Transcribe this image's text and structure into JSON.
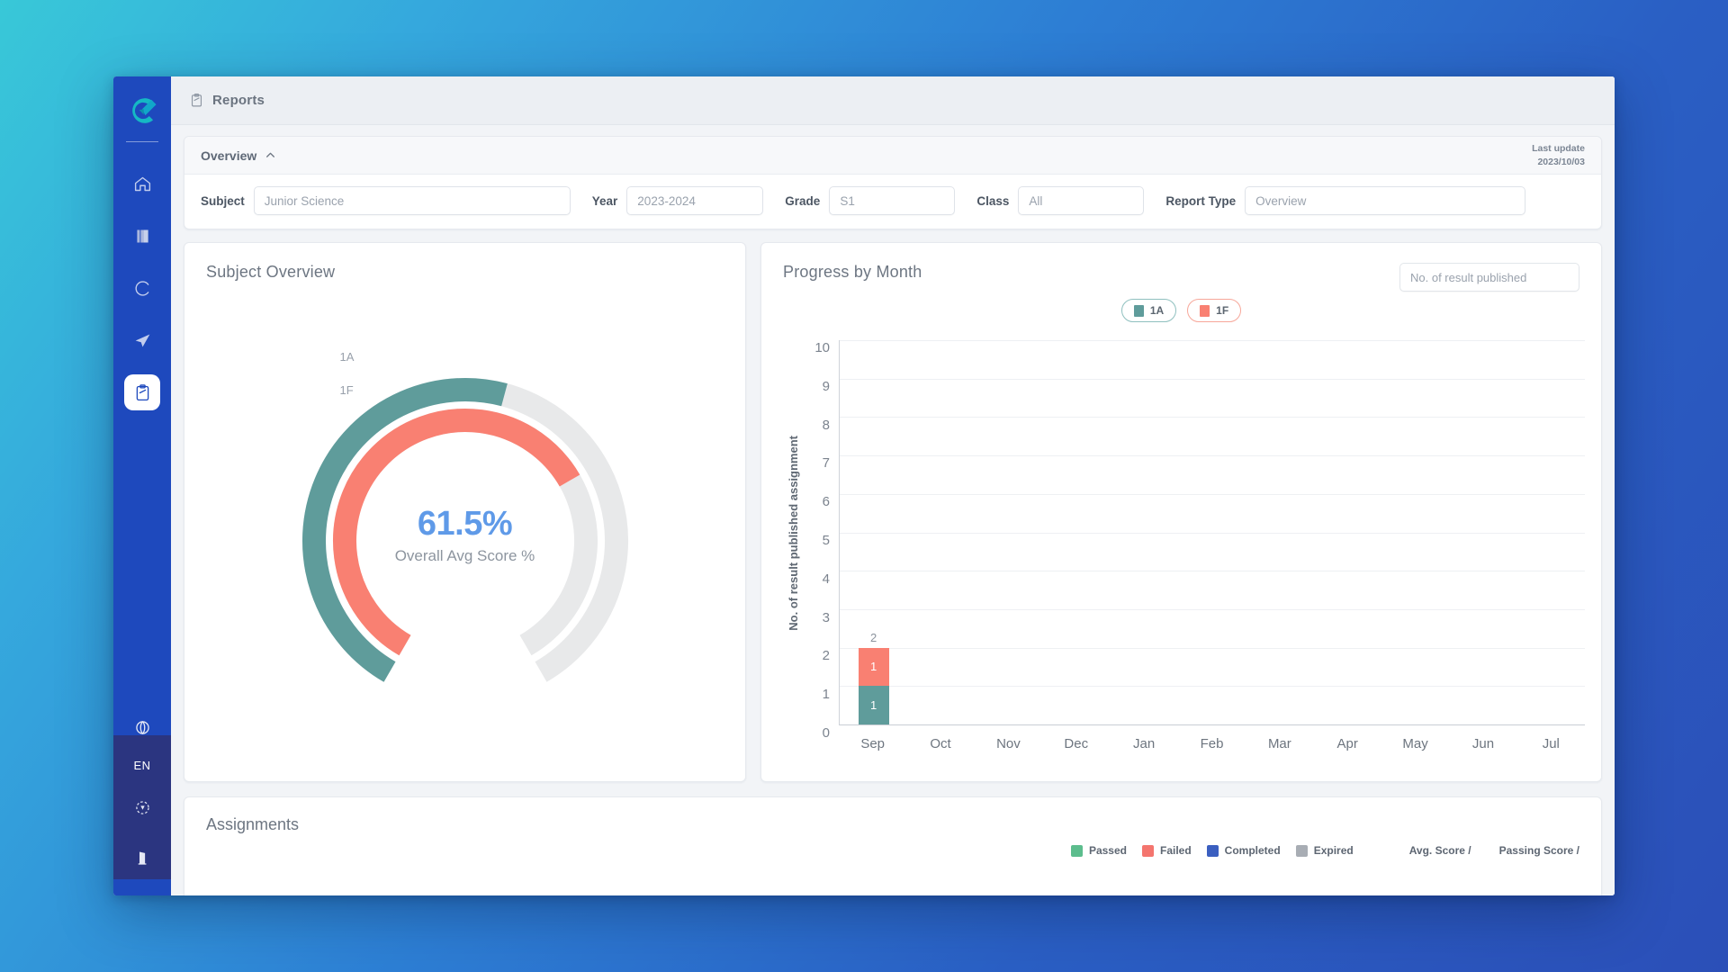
{
  "window": {
    "topbar": {
      "title": "Reports",
      "icon": "clipboard-icon"
    }
  },
  "sidebar": {
    "logo": "e-logo",
    "items": [
      {
        "name": "home",
        "icon": "home-icon"
      },
      {
        "name": "library",
        "icon": "book-icon"
      },
      {
        "name": "history",
        "icon": "clock-icon"
      },
      {
        "name": "messages",
        "icon": "paper-plane-icon"
      },
      {
        "name": "reports",
        "icon": "clipboard-icon",
        "active": true
      }
    ],
    "bottom_items": [
      {
        "name": "globe",
        "icon": "globe-icon"
      },
      {
        "name": "language",
        "label": "EN"
      },
      {
        "name": "help",
        "icon": "help-icon"
      },
      {
        "name": "logout",
        "icon": "door-exit-icon"
      }
    ]
  },
  "filters": {
    "section_label": "Overview",
    "collapse_icon": "chevron-up-icon",
    "last_update_label": "Last update",
    "last_update_value": "2023/10/03",
    "fields": [
      {
        "label": "Subject",
        "value": "Junior Science"
      },
      {
        "label": "Year",
        "value": "2023-2024"
      },
      {
        "label": "Grade",
        "value": "S1"
      },
      {
        "label": "Class",
        "value": "All"
      },
      {
        "label": "Report Type",
        "value": "Overview"
      }
    ]
  },
  "subject_overview": {
    "title": "Subject Overview",
    "center_value": "61.5%",
    "center_caption": "Overall Avg Score %",
    "arc_labels": [
      "1A",
      "1F"
    ],
    "chart_data": {
      "type": "pie",
      "title": "Subject Overview",
      "subtitle": "Overall Avg Score %",
      "center_value": 61.5,
      "series": [
        {
          "name": "1A",
          "value": 55.0,
          "color": "#5f9c9b",
          "track_color": "#e8e9ea",
          "ring": "outer"
        },
        {
          "name": "1F",
          "value": 70.0,
          "color": "#f98072",
          "track_color": "#e8e9ea",
          "ring": "inner"
        }
      ],
      "sweep_degrees": 300,
      "start_angle_degrees": -150,
      "legend_position": "inline-left"
    }
  },
  "progress_by_month": {
    "title": "Progress by Month",
    "metric_select": "No. of result published",
    "legend": [
      {
        "label": "1A",
        "color": "#5f9c9b"
      },
      {
        "label": "1F",
        "color": "#f98072"
      }
    ],
    "chart_data": {
      "type": "bar",
      "stacked": true,
      "title": "Progress by Month",
      "xlabel": "",
      "ylabel": "No. of result published assignment",
      "categories": [
        "Sep",
        "Oct",
        "Nov",
        "Dec",
        "Jan",
        "Feb",
        "Mar",
        "Apr",
        "May",
        "Jun",
        "Jul"
      ],
      "yticks": [
        0,
        1,
        2,
        3,
        4,
        5,
        6,
        7,
        8,
        9,
        10
      ],
      "ylim": [
        0,
        10
      ],
      "grid": true,
      "legend_position": "top-center",
      "series": [
        {
          "name": "1A",
          "color": "#5f9c9b",
          "values": [
            1,
            0,
            0,
            0,
            0,
            0,
            0,
            0,
            0,
            0,
            0
          ]
        },
        {
          "name": "1F",
          "color": "#f98072",
          "values": [
            1,
            0,
            0,
            0,
            0,
            0,
            0,
            0,
            0,
            0,
            0
          ]
        }
      ],
      "totals": [
        2,
        0,
        0,
        0,
        0,
        0,
        0,
        0,
        0,
        0,
        0
      ]
    }
  },
  "assignments": {
    "title": "Assignments",
    "legend": [
      {
        "label": "Passed",
        "color": "#5cbd8d"
      },
      {
        "label": "Failed",
        "color": "#f4756e"
      },
      {
        "label": "Completed",
        "color": "#3b5fc0"
      },
      {
        "label": "Expired",
        "color": "#a8adb4"
      }
    ],
    "metrics": [
      "Avg. Score /",
      "Passing Score /"
    ]
  },
  "colors": {
    "brand_blue": "#1e49bd",
    "sidebar_bottom": "#2b3580",
    "teal": "#5f9c9b",
    "coral": "#f98072",
    "value_blue": "#5f9ae8",
    "track_gray": "#e8e9ea"
  }
}
